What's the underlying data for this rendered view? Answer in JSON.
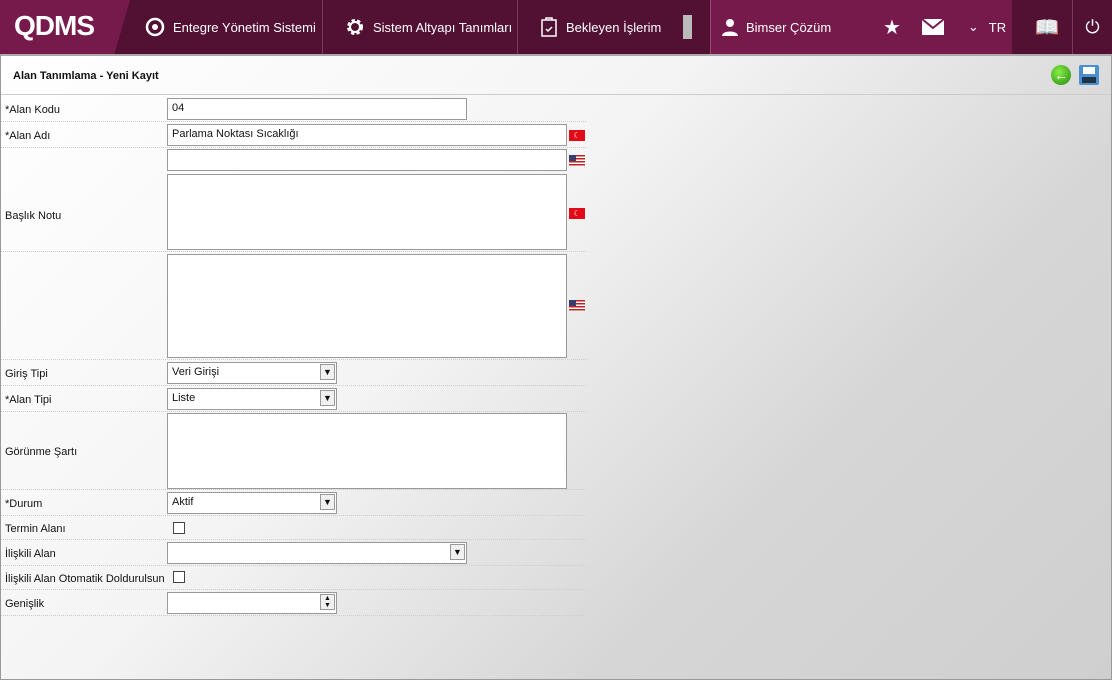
{
  "header": {
    "logo": "QDMS",
    "nav": [
      "Entegre Yönetim Sistemi",
      "Sistem Altyapı Tanımları",
      "Bekleyen İşlerim"
    ],
    "user": "Bimser Çözüm",
    "language": "TR"
  },
  "page": {
    "title": "Alan Tanımlama - Yeni Kayıt"
  },
  "form": {
    "alan_kodu": {
      "label": "*Alan Kodu",
      "value": "04"
    },
    "alan_adi": {
      "label": "*Alan Adı",
      "value": "Parlama Noktası Sıcaklığı",
      "value_en": ""
    },
    "baslik_notu": {
      "label": "Başlık Notu"
    },
    "giris_tipi": {
      "label": "Giriş Tipi",
      "value": "Veri Girişi"
    },
    "alan_tipi": {
      "label": "*Alan Tipi",
      "value": "Liste"
    },
    "gorunme_sarti": {
      "label": "Görünme Şartı"
    },
    "durum": {
      "label": "*Durum",
      "value": "Aktif"
    },
    "termin_alani": {
      "label": "Termin Alanı"
    },
    "iliskili_alan": {
      "label": "İlişkili Alan",
      "value": ""
    },
    "iliskili_otomatik": {
      "label": "İlişkili Alan Otomatik Doldurulsun"
    },
    "genislik": {
      "label": "Genişlik",
      "value": ""
    },
    "flag_tr": "TR",
    "flag_en": "EN"
  }
}
